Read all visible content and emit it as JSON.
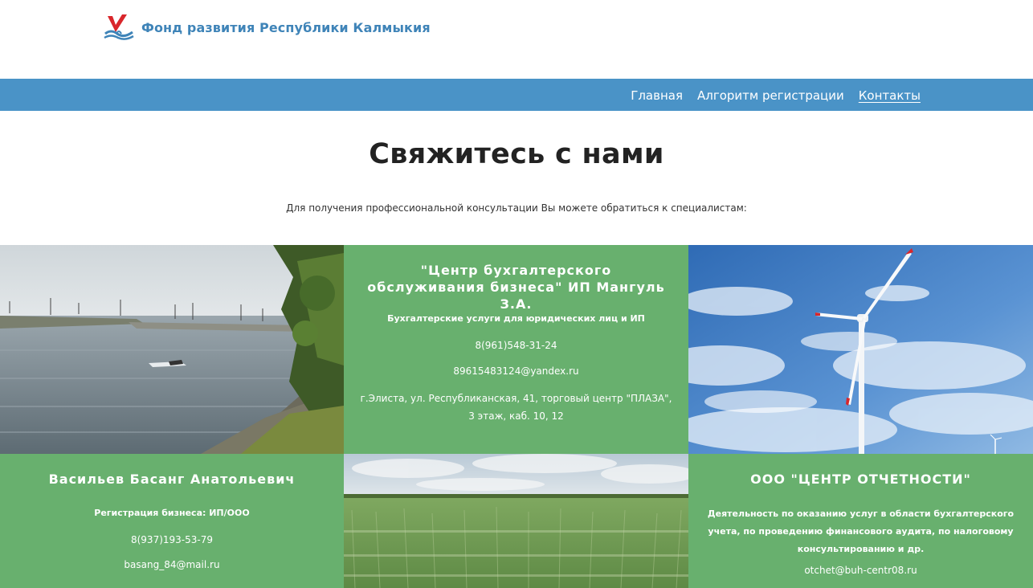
{
  "header": {
    "logo_text": "Фонд развития Республики Калмыкия"
  },
  "nav": {
    "items": [
      {
        "label": "Главная"
      },
      {
        "label": "Алгоритм регистрации"
      },
      {
        "label": "Контакты"
      }
    ]
  },
  "main": {
    "title": "Свяжитесь с нами",
    "intro": "Для получения профессиональной консультации Вы можете обратиться к специалистам:"
  },
  "cards": {
    "center_buh": {
      "title": "\"Центр бухгалтерского обслуживания бизнеса\" ИП Мангуль З.А.",
      "subtitle": "Бухгалтерские услуги для юридических лиц и ИП",
      "phone": "8(961)548-31-24",
      "email": "89615483124@yandex.ru",
      "address_line1": "г.Элиста, ул. Республиканская, 41, торговый центр \"ПЛАЗА\",",
      "address_line2": "3 этаж, каб. 10, 12"
    },
    "vasiliev": {
      "title": "Васильев Басанг Анатольевич",
      "subtitle": "Регистрация бизнеса: ИП/ООО",
      "phone": "8(937)193-53-79",
      "email": "basang_84@mail.ru"
    },
    "otchet": {
      "title": "ООО \"ЦЕНТР ОТЧЕТНОСТИ\"",
      "description": "Деятельность по оказанию услуг в области бухгалтерского учета, по проведению финансового аудита, по налоговому консультированию и др.",
      "email": "otchet@buh-centr08.ru"
    }
  },
  "colors": {
    "brand_blue": "#3f84b8",
    "nav_blue": "#4a93c7",
    "card_green": "#68b06e",
    "logo_red": "#d9262b"
  },
  "images": {
    "tile1": "river-with-wind-turbines-photo",
    "tile3": "wind-turbine-sky-photo",
    "tile5": "wheat-field-photo"
  }
}
